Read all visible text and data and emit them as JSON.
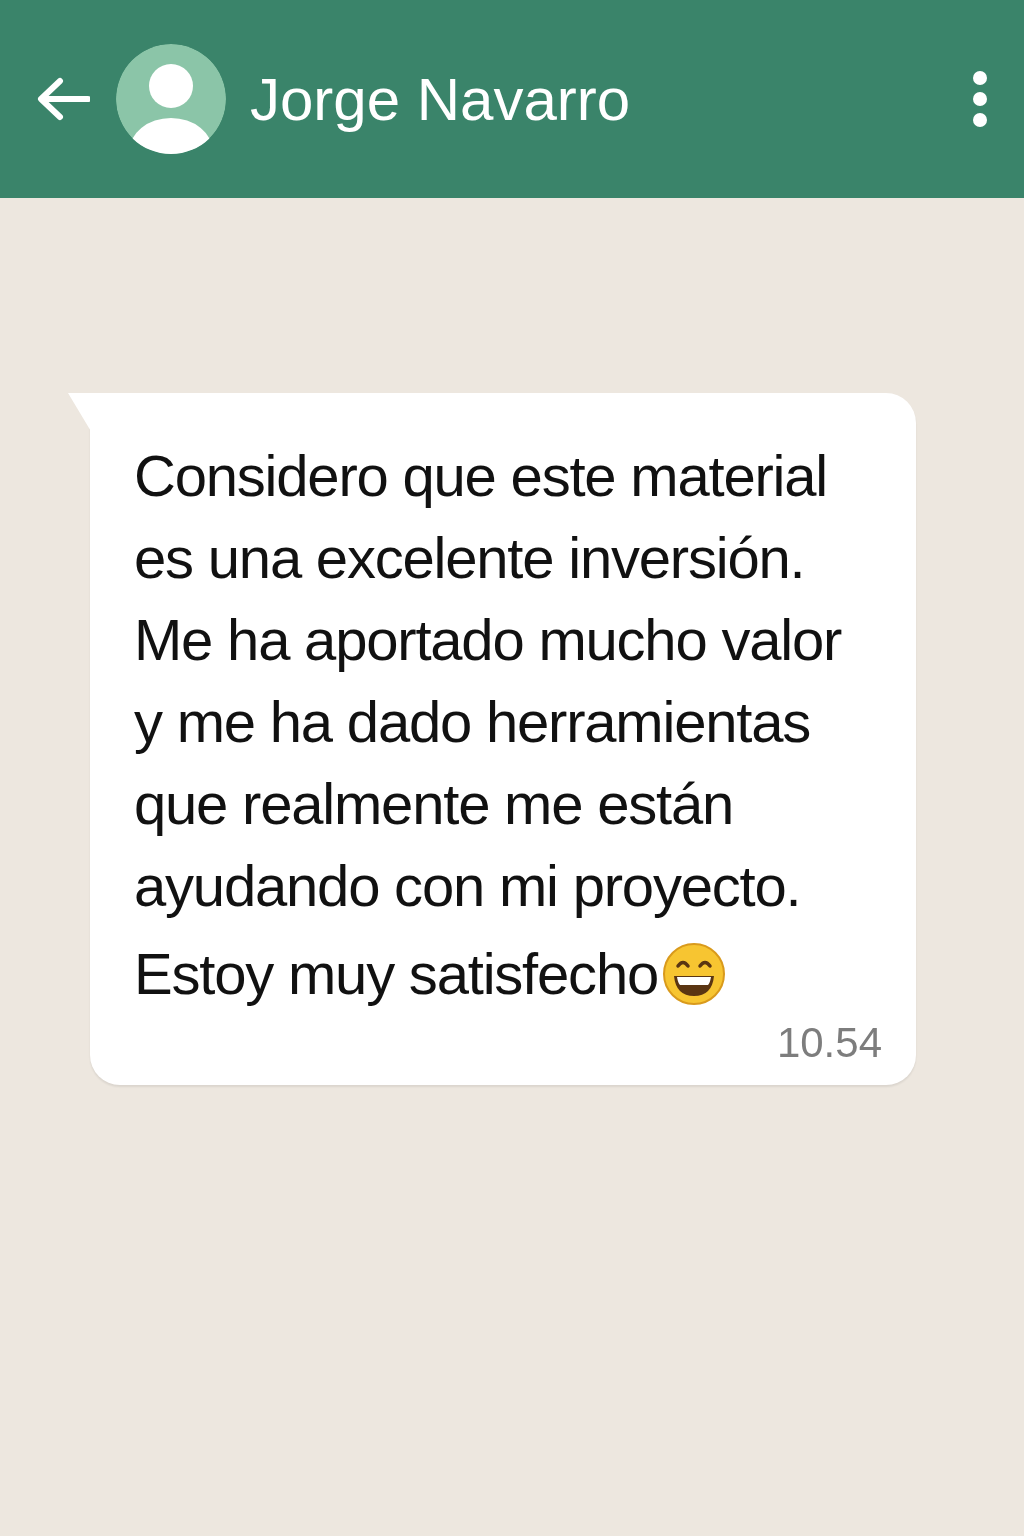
{
  "header": {
    "contact_name": "Jorge Navarro"
  },
  "messages": [
    {
      "text": "Considero que este material es una excelente inversión. Me ha aportado mucho valor y me ha dado herramientas que realmente me están ayudando con mi proyecto.",
      "closing": "Estoy muy satisfecho",
      "time": "10.54"
    }
  ]
}
